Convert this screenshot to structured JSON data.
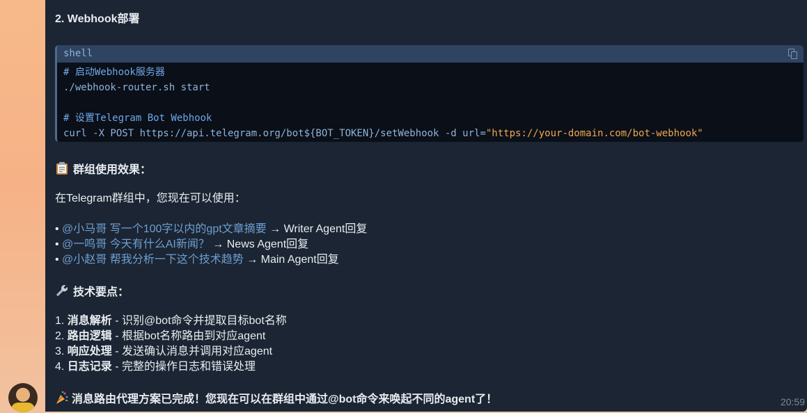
{
  "message": {
    "heading": "2. Webhook部署",
    "code_block": {
      "language": "shell",
      "lines": {
        "comment1": "# 启动Webhook服务器",
        "cmd1": "./webhook-router.sh start",
        "comment2": "# 设置Telegram Bot Webhook",
        "cmd2_prefix": "curl -X POST https://api.telegram.org/bot${BOT_TOKEN}/setWebhook -d url=",
        "cmd2_string": "\"https://your-domain.com/bot-webhook\""
      }
    },
    "section1_title": "群组使用效果：",
    "section1_intro": "在Telegram群组中，您现在可以使用：",
    "usage": [
      {
        "bullet": "• ",
        "mention": "@小马哥 写一个100字以内的gpt文章摘要",
        "result": " → Writer Agent回复"
      },
      {
        "bullet": "• ",
        "mention": "@一鸣哥 今天有什么AI新闻？",
        "result": " → News Agent回复"
      },
      {
        "bullet": "• ",
        "mention": "@小赵哥 帮我分析一下这个技术趋势",
        "result": " → Main Agent回复"
      }
    ],
    "section2_title": "技术要点：",
    "points": [
      {
        "num": "1. ",
        "term": "消息解析",
        "desc": " - 识别@bot命令并提取目标bot名称"
      },
      {
        "num": "2. ",
        "term": "路由逻辑",
        "desc": " - 根据bot名称路由到对应agent"
      },
      {
        "num": "3. ",
        "term": "响应处理",
        "desc": " - 发送确认消息并调用对应agent"
      },
      {
        "num": "4. ",
        "term": "日志记录",
        "desc": " - 完整的操作日志和错误处理"
      }
    ],
    "final": "消息路由代理方案已完成！您现在可以在群组中通过@bot命令来唤起不同的agent了！",
    "time": "20:59"
  },
  "icons": {
    "clipboard": "clipboard-icon",
    "wrench": "wrench-icon",
    "celebration": "celebration-icon",
    "copy": "copy-icon"
  },
  "colors": {
    "bubble": "#1b2533",
    "code_header": "#2e4460",
    "mention": "#6f9fd2",
    "string": "#f0a74f"
  }
}
